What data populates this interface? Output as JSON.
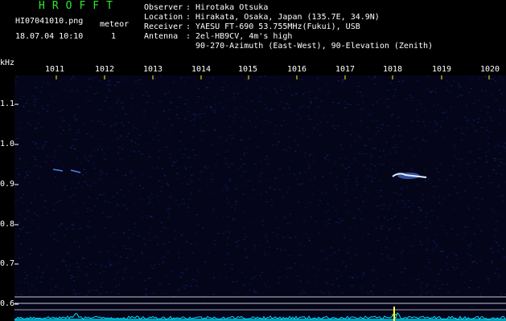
{
  "app": {
    "title": "HROFFT",
    "filename": "HI07041010.png",
    "datetime": "18.07.04 10:10",
    "meteor_label": "meteor",
    "meteor_count": "1"
  },
  "info": [
    {
      "label": "Observer",
      "value": ": Hirotaka Otsuka"
    },
    {
      "label": "Location",
      "value": ": Hirakata, Osaka, Japan (135.7E, 34.9N)"
    },
    {
      "label": "Receiver",
      "value": ": YAESU FT-690 53.755MHz(Fukui), USB"
    },
    {
      "label": "Antenna",
      "value": ": 2el-HB9CV, 4m's high"
    },
    {
      "label": "",
      "value": "  90-270-Azimuth (East-West), 90-Elevation (Zenith)"
    }
  ],
  "axes": {
    "unit": "kHz",
    "x_ticks": [
      "1011",
      "1012",
      "1013",
      "1014",
      "1015",
      "1016",
      "1017",
      "1018",
      "1019",
      "1020"
    ],
    "y_ticks": [
      "1.1",
      "1.0",
      "0.9",
      "0.8",
      "0.7",
      "0.6"
    ]
  },
  "colors": {
    "background": "#000000",
    "title": "#2ee82e",
    "text": "#ffffff",
    "tick": "#ffff00",
    "noise": "#1a2a8a",
    "echo": "#5a8aff",
    "echo_core": "#e0f0ff",
    "spectrum": "#00e0ff",
    "spike": "#ffff30",
    "lines": "#c8c8c8"
  }
}
